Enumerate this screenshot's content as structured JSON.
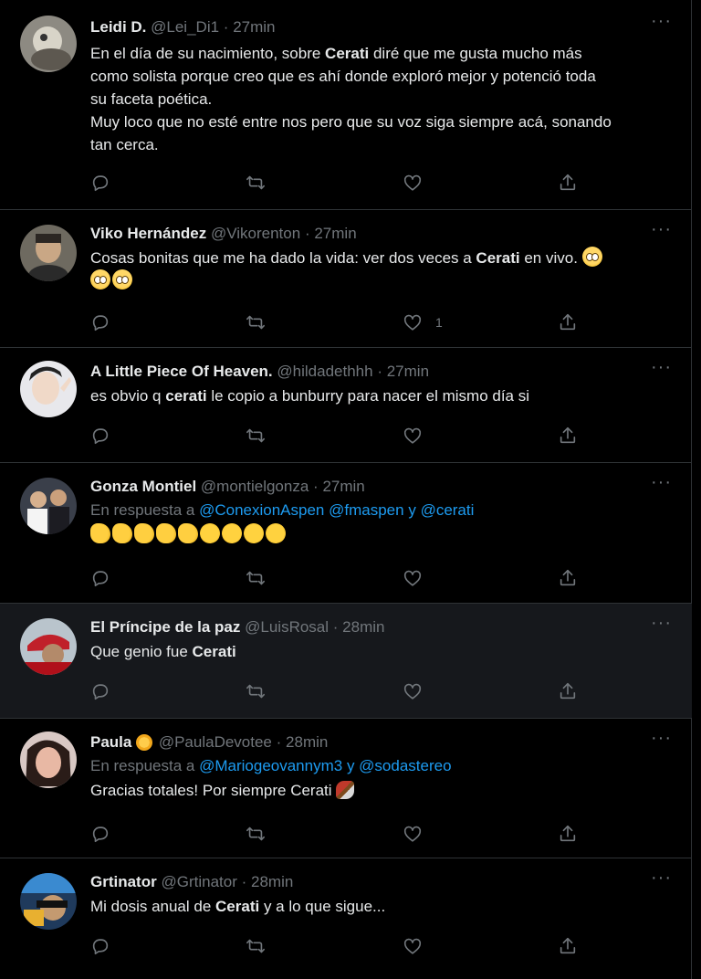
{
  "tweets": [
    {
      "name": "Leidi D.",
      "handle": "@Lei_Di1",
      "time": "27min",
      "text_parts": [
        [
          "En el día de su nacimiento, sobre ",
          "Cerati",
          " diré que me gusta mucho más"
        ],
        [
          "como solista porque creo que es ahí donde exploró mejor y potenció toda"
        ],
        [
          "su faceta poética."
        ],
        [
          "Muy loco que no esté entre nos pero que su voz siga siempre acá, sonando"
        ],
        [
          "tan cerca."
        ]
      ],
      "likes": ""
    },
    {
      "name": "Viko Hernández",
      "handle": "@Vikorenton",
      "time": "27min",
      "text_before": "Cosas bonitas que me ha dado la vida: ver dos veces a ",
      "text_bold": "Cerati",
      "text_after": " en vivo.",
      "likes": "1"
    },
    {
      "name": "A Little Piece Of Heaven.",
      "handle": "@hildadethhh",
      "time": "27min",
      "text_before": "es obvio q ",
      "text_bold": "cerati",
      "text_after": " le copio a bunburry para nacer el mismo día si"
    },
    {
      "name": "Gonza Montiel",
      "handle": "@montielgonza",
      "time": "27min",
      "reply_prefix": "En respuesta a",
      "mentions": [
        "@ConexionAspen",
        "@fmaspen",
        "@cerati"
      ],
      "joiner": "y"
    },
    {
      "name": "El Príncipe de la paz",
      "handle": "@LuisRosal",
      "time": "28min",
      "text_before": "Que genio fue ",
      "text_bold": "Cerati",
      "text_after": ""
    },
    {
      "name": "Paula",
      "handle": "@PaulaDevotee",
      "time": "28min",
      "reply_prefix": "En respuesta a",
      "mentions": [
        "@Mariogeovannym3",
        "@sodastereo"
      ],
      "joiner": "y",
      "text": "Gracias totales! Por siempre Cerati"
    },
    {
      "name": "Grtinator",
      "handle": "@Grtinator",
      "time": "28min",
      "text_before": "Mi dosis anual de ",
      "text_bold": "Cerati",
      "text_after": " y a lo que sigue..."
    }
  ],
  "icons": {
    "reply": "reply-icon",
    "retweet": "retweet-icon",
    "like": "heart-icon",
    "share": "share-icon",
    "more": "more-icon"
  },
  "more_glyph": "···",
  "separator": "·",
  "colors": {
    "background": "#000000",
    "highlight_background": "#16181c",
    "text": "#e7e9ea",
    "muted": "#71767b",
    "link": "#1d9bf0",
    "divider": "#2f3336"
  }
}
